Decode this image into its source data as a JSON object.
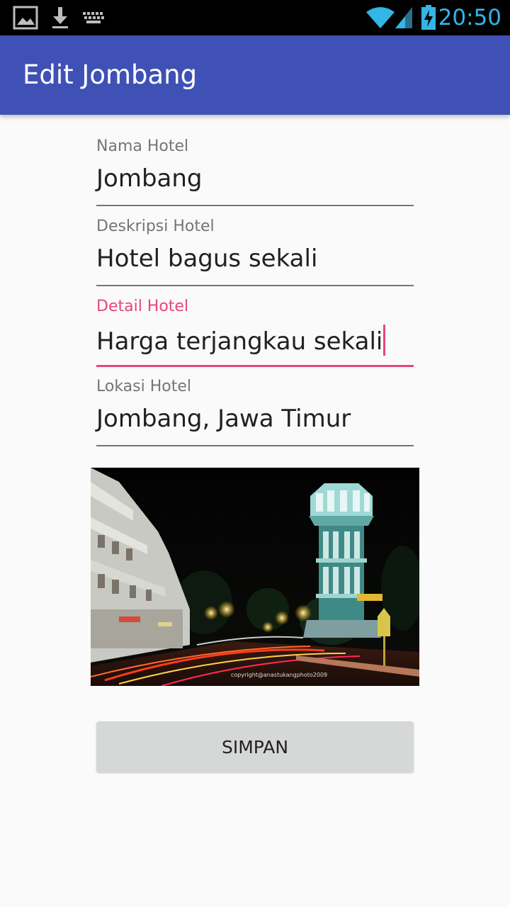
{
  "status_bar": {
    "time": "20:50",
    "icons": [
      "image-icon",
      "download-icon",
      "keyboard-icon",
      "wifi-icon",
      "signal-icon",
      "battery-charging-icon"
    ],
    "accent_color": "#33b5e5"
  },
  "app_bar": {
    "title": "Edit Jombang",
    "color": "#3f51b5"
  },
  "form": {
    "nama": {
      "label": "Nama Hotel",
      "value": "Jombang"
    },
    "deskripsi": {
      "label": "Deskripsi Hotel",
      "value": "Hotel bagus sekali"
    },
    "detail": {
      "label": "Detail Hotel",
      "value": "Harga terjangkau sekali",
      "focused": true
    },
    "lokasi": {
      "label": "Lokasi Hotel",
      "value": "Jombang, Jawa Timur"
    },
    "focus_color": "#e8457e"
  },
  "photo": {
    "caption": "copyright@anastukangphoto2009"
  },
  "save_button": {
    "label": "SIMPAN"
  }
}
